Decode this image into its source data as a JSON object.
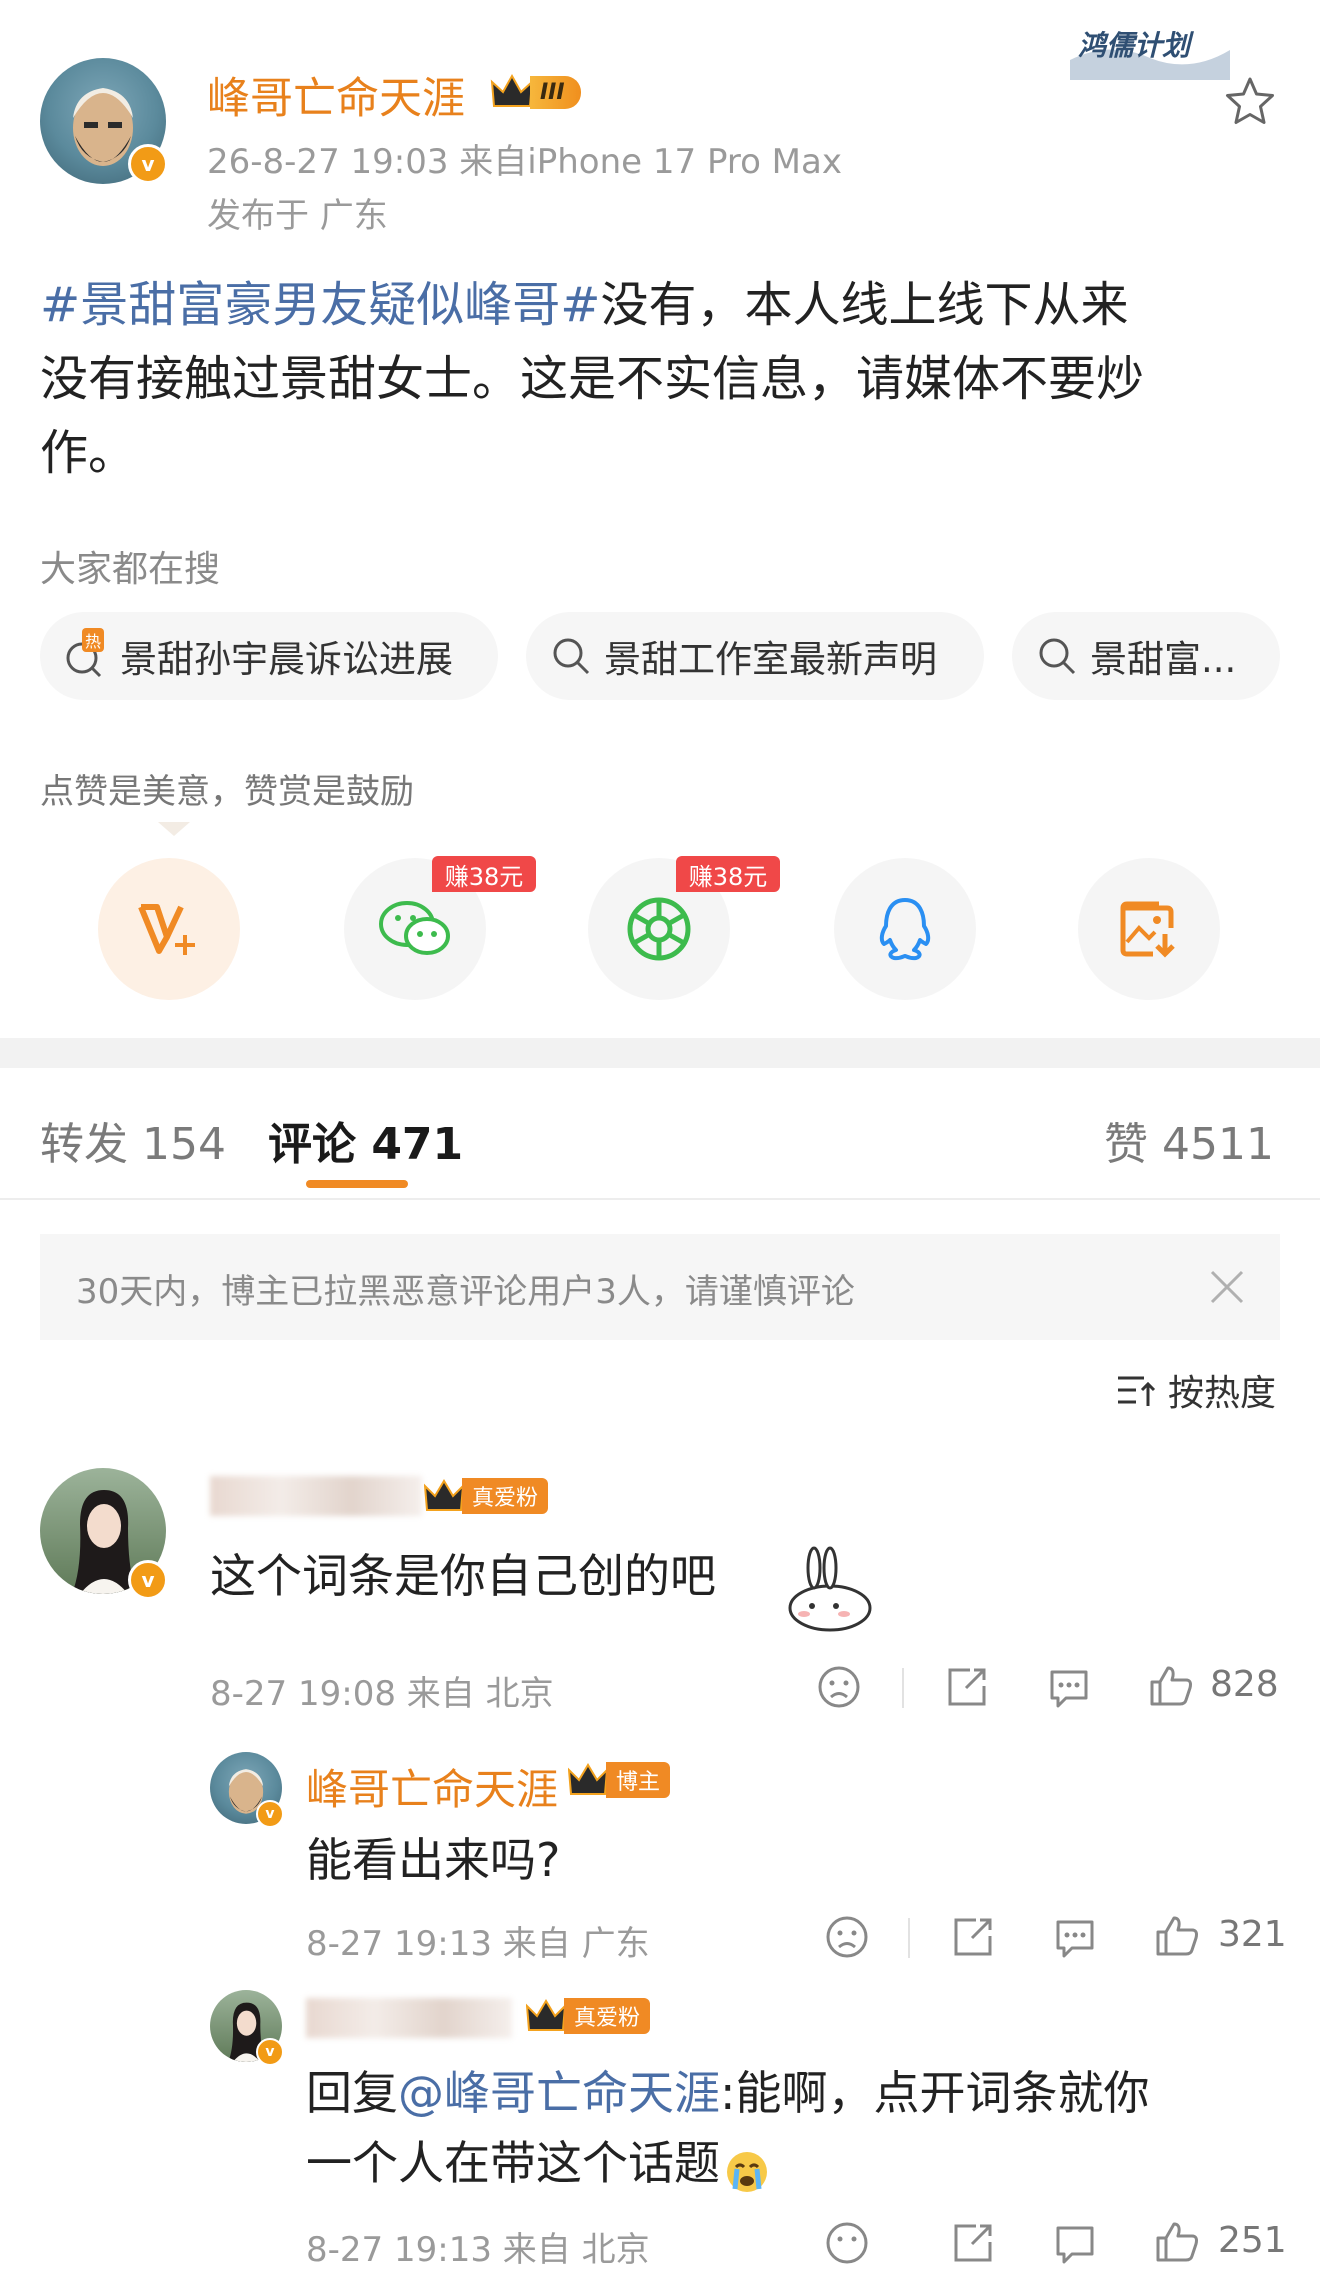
{
  "post": {
    "watermark": "鸿儒计划",
    "author_name": "峰哥亡命天涯",
    "level_badge": "III",
    "meta_line": "26-8-27 19:03  来自iPhone 17 Pro Max",
    "location": "发布于 广东",
    "hashtag": "#景甜富豪男友疑似峰哥#",
    "body_line1": "没有，本人线上线下从来",
    "body_line2": "没有接触过景甜女士。这是不实信息，请媒体不要炒",
    "body_line3": "作。"
  },
  "search_section": {
    "title": "大家都在搜",
    "hot_label": "热",
    "tags": [
      "景甜孙宇晨诉讼进展",
      "景甜工作室最新声明",
      "景甜富..."
    ]
  },
  "share_section": {
    "hint": "点赞是美意，赞赏是鼓励",
    "earn_label": "赚38元",
    "buttons": [
      "reward-icon",
      "wechat-icon",
      "moments-icon",
      "qq-icon",
      "save-image-icon"
    ]
  },
  "tabs": {
    "repost": "转发 154",
    "comment": "评论 471",
    "like": "赞 4511",
    "active": "comment"
  },
  "notice": {
    "text": "30天内，博主已拉黑恶意评论用户3人，请谨慎评论"
  },
  "sort": {
    "label": "按热度"
  },
  "comments": [
    {
      "badge": "真爱粉",
      "text": "这个词条是你自己创的吧",
      "meta": "8-27 19:08 来自 北京",
      "likes": "828"
    },
    {
      "name": "峰哥亡命天涯",
      "badge": "博主",
      "text": "能看出来吗?",
      "meta": "8-27 19:13 来自 广东",
      "likes": "321"
    },
    {
      "badge": "真爱粉",
      "reply_prefix": "回复",
      "reply_to": "@峰哥亡命天涯",
      "reply_colon": ":",
      "text_line1": "能啊，点开词条就你",
      "text_line2": "一个人在带这个话题",
      "meta": "8-27 19:13 来自 北京",
      "likes": "251"
    }
  ]
}
